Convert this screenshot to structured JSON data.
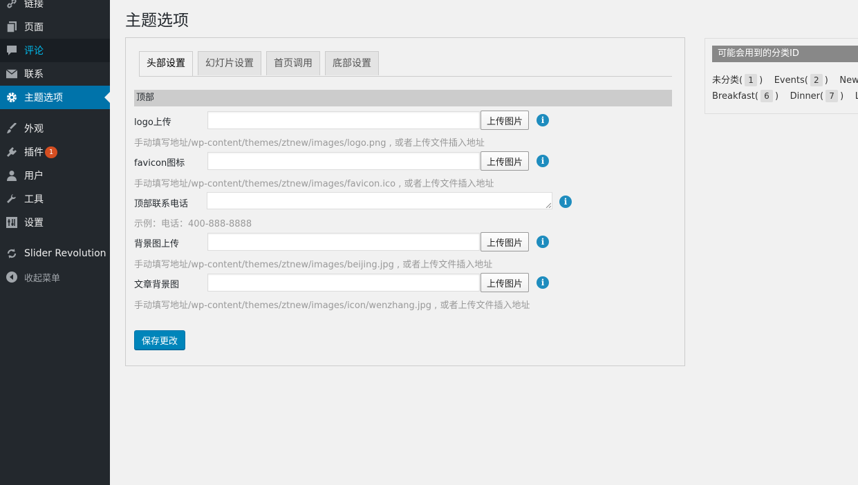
{
  "sidebar": {
    "items": [
      {
        "label": "链接",
        "icon": "link-icon"
      },
      {
        "label": "页面",
        "icon": "page-icon"
      },
      {
        "label": "评论",
        "icon": "comment-icon"
      },
      {
        "label": "联系",
        "icon": "mail-icon"
      },
      {
        "label": "主题选项",
        "icon": "gear-icon"
      },
      {
        "label": "外观",
        "icon": "brush-icon"
      },
      {
        "label": "插件",
        "icon": "plugin-icon",
        "badge": "1"
      },
      {
        "label": "用户",
        "icon": "user-icon"
      },
      {
        "label": "工具",
        "icon": "wrench-icon"
      },
      {
        "label": "设置",
        "icon": "settings-icon"
      },
      {
        "label": "Slider Revolution",
        "icon": "refresh-icon"
      },
      {
        "label": "收起菜单",
        "icon": "collapse-icon"
      }
    ]
  },
  "page": {
    "title": "主题选项"
  },
  "tabs": [
    "头部设置",
    "幻灯片设置",
    "首页调用",
    "底部设置"
  ],
  "section": {
    "title": "顶部"
  },
  "fields": [
    {
      "label": "logo上传",
      "button": "上传图片",
      "hint": "手动填写地址/wp-content/themes/ztnew/images/logo.png , 或者上传文件插入地址"
    },
    {
      "label": "favicon图标",
      "button": "上传图片",
      "hint": "手动填写地址/wp-content/themes/ztnew/images/favicon.ico , 或者上传文件插入地址"
    },
    {
      "label": "顶部联系电话",
      "hint": "示例：电话：400-888-8888"
    },
    {
      "label": "背景图上传",
      "button": "上传图片",
      "hint": "手动填写地址/wp-content/themes/ztnew/images/beijing.jpg , 或者上传文件插入地址"
    },
    {
      "label": "文章背景图",
      "button": "上传图片",
      "hint": "手动填写地址/wp-content/themes/ztnew/images/icon/wenzhang.jpg , 或者上传文件插入地址"
    }
  ],
  "save_label": "保存更改",
  "categories": {
    "title": "可能会用到的分类ID",
    "row1": [
      {
        "name": "未分类",
        "id": "1"
      },
      {
        "name": "Events",
        "id": "2"
      },
      {
        "name": "New",
        "id": ""
      }
    ],
    "row2": [
      {
        "name": "Breakfast",
        "id": "6"
      },
      {
        "name": "Dinner",
        "id": "7"
      },
      {
        "name": "Lu",
        "id": ""
      }
    ]
  },
  "colors": {
    "sidebar": "#23282d",
    "active": "#0073aa",
    "accent": "#1e8cbe",
    "badge": "#d54e21"
  }
}
